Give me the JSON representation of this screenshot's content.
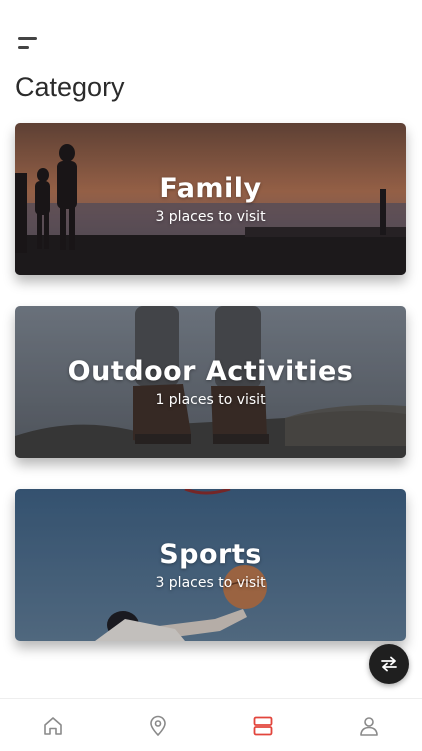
{
  "header": {
    "menu_icon": "menu-icon",
    "title": "Category"
  },
  "categories": [
    {
      "name": "Family",
      "count_text": "3 places to visit"
    },
    {
      "name": "Outdoor Activities",
      "count_text": "1 places to visit"
    },
    {
      "name": "Sports",
      "count_text": "3 places to visit"
    }
  ],
  "fab": {
    "icon": "swap-arrows-icon"
  },
  "bottom_nav": {
    "items": [
      {
        "icon": "home-icon",
        "active": false
      },
      {
        "icon": "map-pin-icon",
        "active": false
      },
      {
        "icon": "category-list-icon",
        "active": true
      },
      {
        "icon": "user-icon",
        "active": false
      }
    ]
  },
  "colors": {
    "accent": "#e2453c",
    "nav_icon": "#8a8a8a",
    "fab_bg": "#1f1f1f",
    "title_text": "#2b2b2b"
  }
}
